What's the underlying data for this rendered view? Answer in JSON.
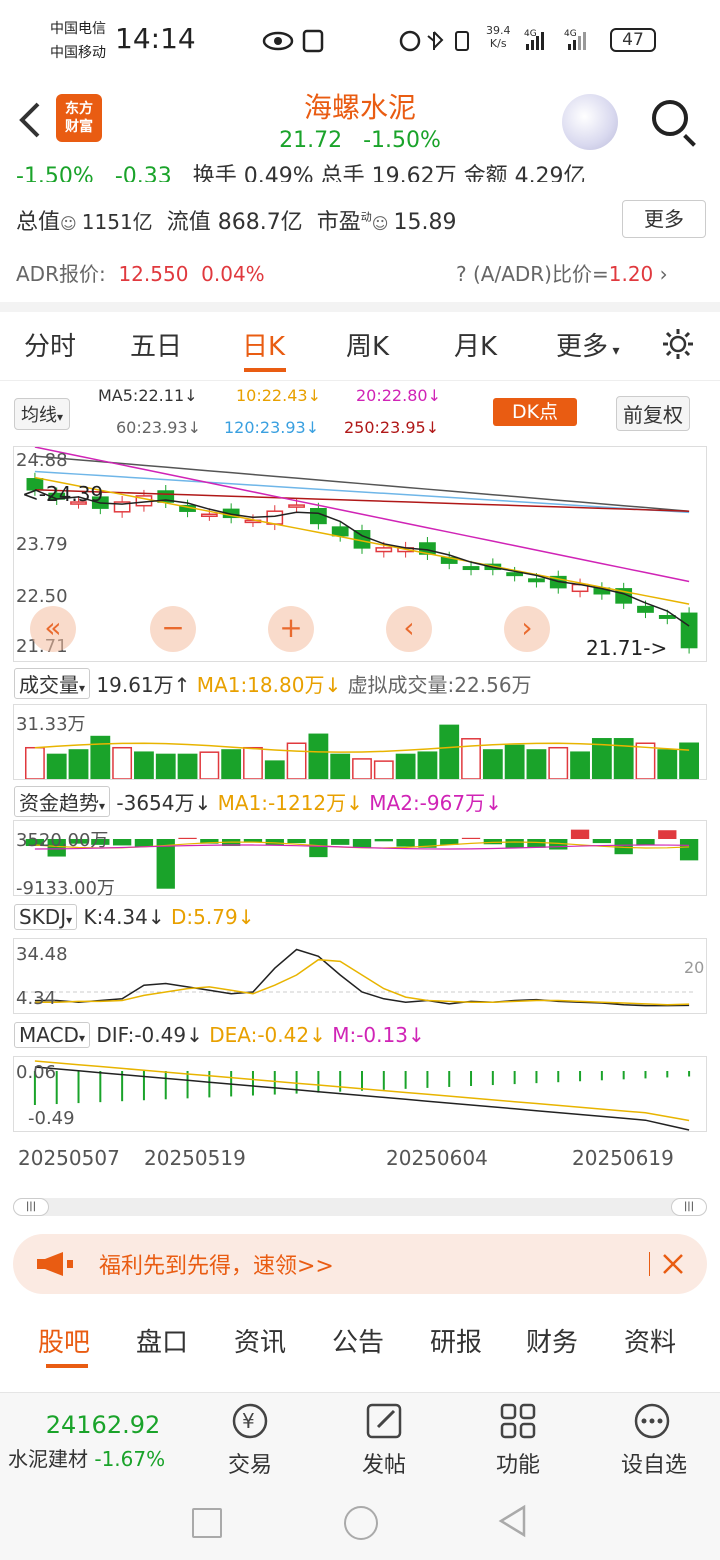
{
  "status_bar": {
    "carrier1": "中国电信",
    "carrier2": "中国移动",
    "time": "14:14",
    "net_speed_top": "39.4",
    "net_speed_bottom": "K/s",
    "battery": "47"
  },
  "header": {
    "logo_line1": "东方",
    "logo_line2": "财富",
    "stock_name": "海螺水泥",
    "price": "21.72",
    "change_pct": "-1.50%"
  },
  "quote": {
    "row0_left": "-1.50%",
    "row0_mid": "-0.33",
    "row0_rest": "换手 0.49%  总手 19.62万  金额  4.29亿",
    "market_cap_label": "总值",
    "market_cap": "1151亿",
    "float_cap_label": "流值",
    "float_cap": "868.7亿",
    "pe_label": "市盈",
    "pe_sup": "动",
    "pe": "15.89",
    "more_button": "更多",
    "adr_label": "ADR报价:",
    "adr_price": "12.550",
    "adr_change": "0.04%",
    "adr_ratio_label": "(A/ADR)比价=",
    "adr_ratio": "1.20"
  },
  "period_tabs": [
    "分时",
    "五日",
    "日K",
    "周K",
    "月K",
    "更多"
  ],
  "ma_header": {
    "selector": "均线",
    "ma5": "MA5:22.11",
    "ma10": "10:22.43",
    "ma20": "20:22.80",
    "ma60": "60:23.93",
    "ma120": "120:23.93",
    "ma250": "250:23.95",
    "dk_button": "DK点",
    "adjust_button": "前复权"
  },
  "colors": {
    "up": "#e0393e",
    "down": "#1aa32a",
    "ma5": "#222222",
    "ma10": "#e8b400",
    "ma20": "#d024b6",
    "ma60": "#555555",
    "ma120": "#6fb6e8",
    "ma250": "#b01818",
    "accent": "#e95c12"
  },
  "kline": {
    "y_labels": [
      "24.88",
      "23.79",
      "22.50",
      "21.71"
    ],
    "high_mark": "24.39",
    "last_mark": "21.71->",
    "zoom_buttons": [
      "«",
      "−",
      "+",
      "‹",
      "›"
    ]
  },
  "volume": {
    "selector": "成交量",
    "value": "19.61万",
    "ma1": "MA1:18.80万",
    "virtual": "虚拟成交量:22.56万",
    "y_max": "31.33万"
  },
  "fund_trend": {
    "selector": "资金趋势",
    "value": "-3654万",
    "ma1": "MA1:-1212万",
    "ma2": "MA2:-967万",
    "y_top": "3520.00万",
    "y_bottom": "-9133.00万"
  },
  "skdj": {
    "selector": "SKDJ",
    "k": "K:4.34",
    "d": "D:5.79",
    "y_top": "34.48",
    "y_bottom": "4.34",
    "level": "20"
  },
  "macd": {
    "selector": "MACD",
    "dif": "DIF:-0.49",
    "dea": "DEA:-0.42",
    "m": "M:-0.13",
    "y_top": "0.06",
    "y_bottom": "-0.49"
  },
  "dates": [
    "20250507",
    "20250519",
    "20250604",
    "20250619"
  ],
  "banner": {
    "text": "福利先到先得，速领>>"
  },
  "bottom_tabs": [
    "股吧",
    "盘口",
    "资讯",
    "公告",
    "研报",
    "财务",
    "资料"
  ],
  "footer": {
    "index_value": "24162.92",
    "index_name": "水泥建材",
    "index_change": "-1.67%",
    "items": [
      "交易",
      "发帖",
      "功能",
      "设自选"
    ]
  }
}
